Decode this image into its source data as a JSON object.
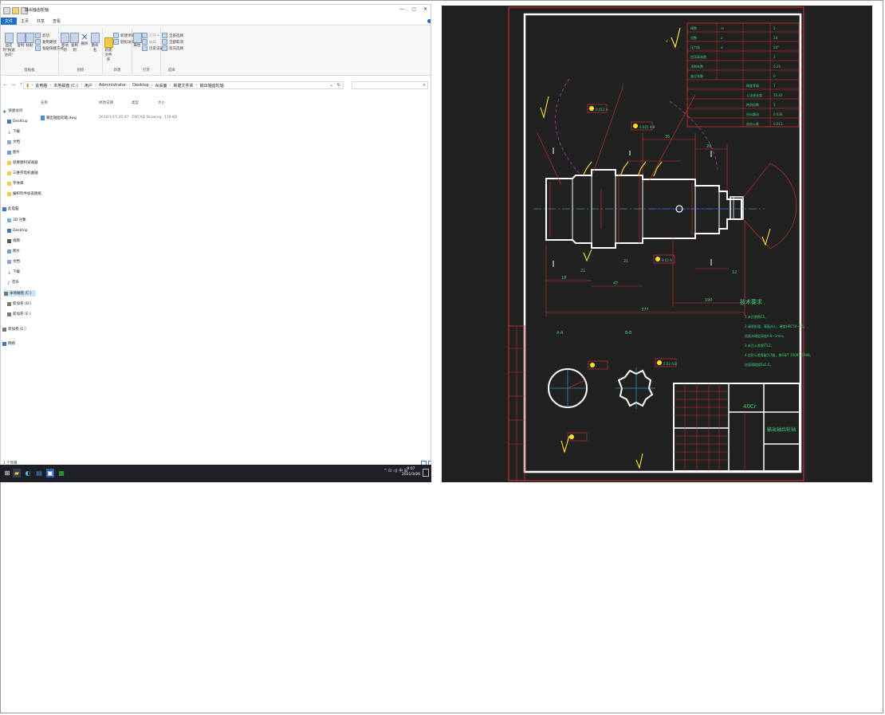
{
  "explorer": {
    "window_title": "输出轴齿轮轴",
    "window_buttons": [
      "—",
      "▢",
      "✕"
    ],
    "ribbon_tabs": [
      "文件",
      "主页",
      "共享",
      "查看"
    ],
    "ribbon": {
      "pin_quick": "固定到\"快速访问\"",
      "copy": "复制",
      "paste": "粘贴",
      "cut": "剪切",
      "copy_path": "复制路径",
      "paste_shortcut": "粘贴快捷方式",
      "move_to": "移动到",
      "copy_to": "复制到",
      "delete": "删除",
      "rename": "重命名",
      "new_folder": "新建\n文件夹",
      "new_item": "新建项目 ▾",
      "easy_access": "轻松访问 ▾",
      "properties": "属性",
      "open": "打开 ▾",
      "edit": "编辑",
      "history": "历史记录",
      "select_all": "全部选择",
      "select_none": "全部取消",
      "invert": "反向选择",
      "groups": [
        "剪贴板",
        "组织",
        "新建",
        "打开",
        "选择"
      ]
    },
    "address": {
      "crumbs": [
        "此电脑",
        "本地磁盘 (C:)",
        "用户",
        "Administrator",
        "Desktop",
        "Ai桌面",
        "新建文件夹",
        "输出轴齿轮轴"
      ],
      "dropdown": "⌄",
      "refresh": "↻"
    },
    "search_icon": "⌕",
    "nav": {
      "quick_access": "快速访问",
      "pinned": [
        "Desktop",
        "下载",
        "文档",
        "图片",
        "就要顺利减速器",
        "三维带电机曲轴",
        "字体库",
        "编织料件加盖图纸"
      ],
      "this_pc": "此电脑",
      "pc_items": [
        "3D 对象",
        "Desktop",
        "视频",
        "图片",
        "文档",
        "下载",
        "音乐",
        "本地磁盘 (C:)",
        "新加卷 (D:)",
        "新加卷 (E:)"
      ],
      "new_volume": "新加卷 (E:)",
      "network": "网络"
    },
    "columns": [
      "名称",
      "修改日期",
      "类型",
      "大小"
    ],
    "files": [
      {
        "name": "输出轴齿轮轴.dwg",
        "date": "2010/1/15 20:47",
        "type": "ZWCAD Drawing",
        "size": "118 KB"
      }
    ],
    "status": "1 个项目"
  },
  "taskbar": {
    "tray": "^ ⊡ ◁) 中 ⊞",
    "time": "9:07",
    "date": "2021/3/26"
  },
  "cad": {
    "tech_title": "技术要求",
    "tech_lines": [
      "1.未注倒角C1。",
      "2.调质处理，表面淬火，硬度HRC50~55。",
      "  齿面淬硬层深度0.8~1mm。",
      "3.未注公差按IT12。",
      "4.齿形公差等级为7级，按GB/T 10095-1988。",
      "  齿面粗糙度Ra1.6。"
    ],
    "material": "40Cr",
    "part_name": "输出轴齿轮轴",
    "section_labels": [
      "A-A",
      "B-B"
    ],
    "dims": [
      "377",
      "190",
      "18",
      "47",
      "35",
      "28",
      "21",
      "21",
      "12"
    ],
    "tolerance_labels": [
      "0.012 A",
      "0.025 A-B",
      "0.02 A",
      "0.02 A-B"
    ],
    "param_rows": 9
  }
}
